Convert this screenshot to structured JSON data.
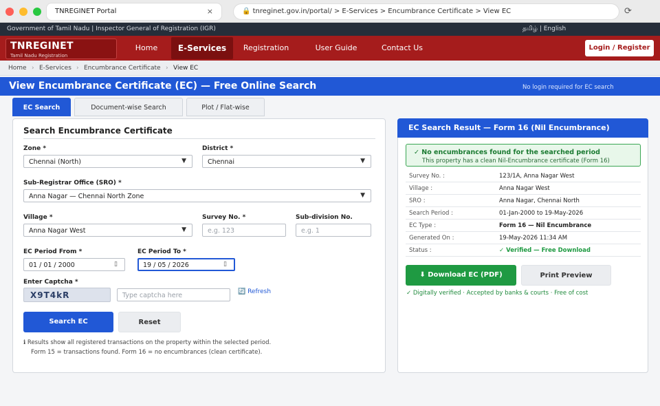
{
  "browser": {
    "tab_title": "TNREGINET Portal",
    "tab_close": "×",
    "url": "🔒 tnreginet.gov.in/portal/ > E-Services > Encumbrance Certificate > View EC",
    "reload": "⟳"
  },
  "gov_strip": {
    "left": "Government of Tamil Nadu  |  Inspector General of Registration (IGR)",
    "right": "தமிழ் | English"
  },
  "brand": {
    "name": "TNREGINET",
    "subtitle": "Tamil Nadu Registration"
  },
  "nav": {
    "items": [
      {
        "label": "Home",
        "active": false
      },
      {
        "label": "E-Services",
        "active": true
      },
      {
        "label": "Registration",
        "active": false
      },
      {
        "label": "User Guide",
        "active": false
      },
      {
        "label": "Contact Us",
        "active": false
      }
    ],
    "login_label": "Login / Register"
  },
  "breadcrumb": [
    "Home",
    "E-Services",
    "Encumbrance Certificate",
    "View EC"
  ],
  "breadcrumb_sep": "›",
  "page_title": "View Encumbrance Certificate (EC) — Free Online Search",
  "page_note": "No login required for EC search",
  "search_tabs": [
    "EC Search",
    "Document-wise Search",
    "Plot / Flat-wise"
  ],
  "form": {
    "title": "Search Encumbrance Certificate",
    "zone": {
      "label": "Zone *",
      "value": "Chennai (North)"
    },
    "district": {
      "label": "District *",
      "value": "Chennai"
    },
    "sro": {
      "label": "Sub-Registrar Office (SRO) *",
      "value": "Anna Nagar — Chennai North Zone"
    },
    "village": {
      "label": "Village *",
      "value": "Anna Nagar West"
    },
    "survey": {
      "label": "Survey No. *",
      "placeholder": "e.g. 123"
    },
    "subdivision": {
      "label": "Sub-division No.",
      "placeholder": "e.g. 1"
    },
    "period_from": {
      "label": "EC Period From *",
      "value": "01 / 01 / 2000"
    },
    "period_to": {
      "label": "EC Period To *",
      "value": "19 / 05 / 2026"
    },
    "captcha": {
      "label": "Enter Captcha *",
      "code": "X9T4kR",
      "placeholder": "Type captcha here",
      "refresh": "🔄 Refresh"
    },
    "search_button": "Search EC",
    "reset_button": "Reset",
    "info_line1": "ℹ  Results show all registered transactions on the property within the selected period.",
    "info_line2": "Form 15 = transactions found.   Form 16 = no encumbrances (clean certificate)."
  },
  "result": {
    "title": "EC Search Result — Form 16 (Nil Encumbrance)",
    "status_main": "✓  No encumbrances found for the searched period",
    "status_sub": "This property has a clean Nil-Encumbrance certificate (Form 16)",
    "rows": [
      {
        "k": "Survey No. :",
        "v": "123/1A, Anna Nagar West"
      },
      {
        "k": "Village :",
        "v": "Anna Nagar West"
      },
      {
        "k": "SRO :",
        "v": "Anna Nagar, Chennai North"
      },
      {
        "k": "Search Period :",
        "v": "01-Jan-2000 to 19-May-2026"
      },
      {
        "k": "EC Type :",
        "v": "Form 16 — Nil Encumbrance"
      },
      {
        "k": "Generated On :",
        "v": "19-May-2026  11:34 AM"
      },
      {
        "k": "Status :",
        "v": "✓ Verified — Free Download"
      }
    ],
    "download_button": "⬇  Download EC (PDF)",
    "print_button": "Print Preview",
    "footer": "✓ Digitally verified  ·  Accepted by banks & courts  ·  Free of cost"
  },
  "colors": {
    "brand_red": "#a51c1c",
    "primary_blue": "#2158d6",
    "success_green": "#1f9a42"
  }
}
